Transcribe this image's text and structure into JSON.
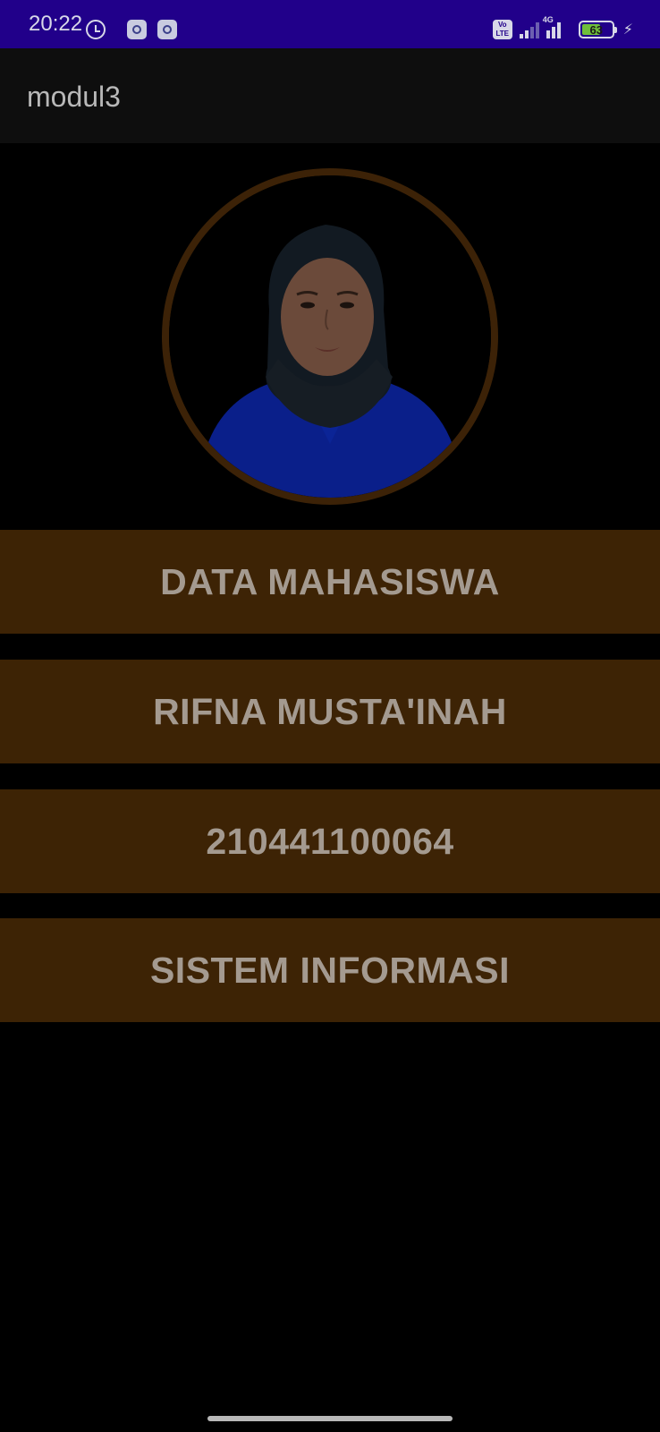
{
  "status_bar": {
    "time": "20:22",
    "volte_line1": "Vo",
    "volte_line2": "LTE",
    "network_type": "4G",
    "battery_level": "63",
    "battery_percent": 63,
    "icons": [
      "alarm-icon",
      "app-notification-icon",
      "app-notification-icon",
      "volte-icon",
      "signal-icon",
      "signal-icon",
      "battery-icon",
      "charging-icon"
    ],
    "background_color": "#21008a"
  },
  "app_bar": {
    "title": "modul3"
  },
  "profile": {
    "photo": "profile-photo",
    "ring_color": "#3c2207"
  },
  "cards": [
    {
      "label": "DATA MAHASISWA"
    },
    {
      "label": "RIFNA MUSTA'INAH"
    },
    {
      "label": "210441100064"
    },
    {
      "label": "SISTEM INFORMASI"
    }
  ],
  "colors": {
    "card_background": "#3d2305",
    "card_text": "#a49a90",
    "app_bar": "#0e0e0e",
    "page_background": "#000000"
  }
}
